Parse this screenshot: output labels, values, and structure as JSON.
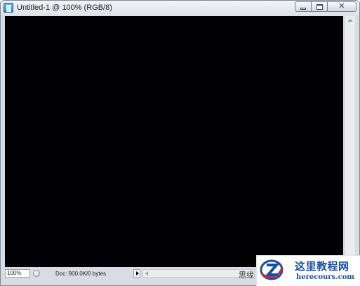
{
  "window": {
    "title": "Untitled-1 @ 100% (RGB/8)",
    "controls": {
      "minimize_icon": "minimize-icon",
      "maximize_icon": "maximize-icon",
      "close_icon": "close-icon",
      "close_glyph": "✕"
    }
  },
  "canvas": {
    "fill_color": "#010003"
  },
  "statusbar": {
    "zoom": "100%",
    "doc_info": "Doc: 900.0K/0 bytes"
  },
  "watermark": {
    "partial_text": "思缘",
    "logo_cn": "这里教程网",
    "logo_en": "herecours.com"
  }
}
